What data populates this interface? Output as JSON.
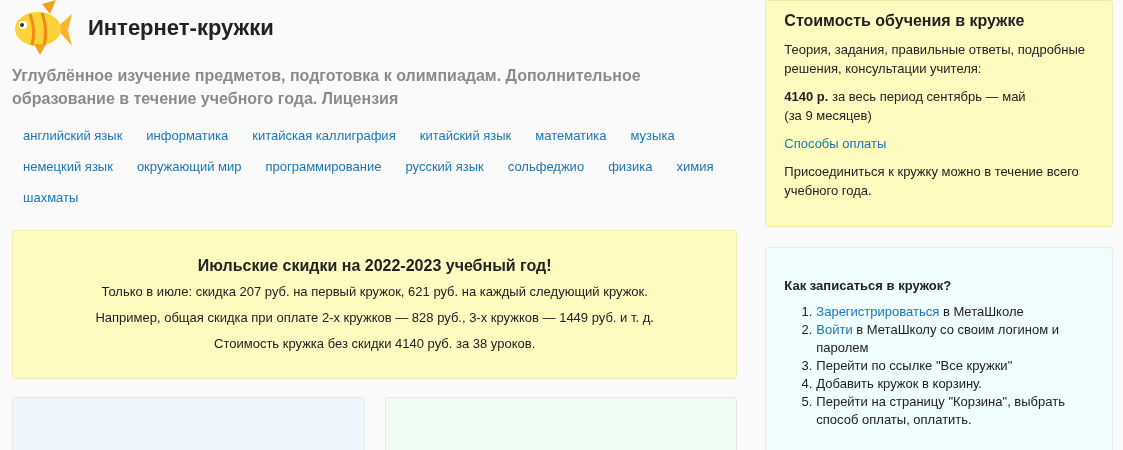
{
  "header": {
    "title": "Интернет-кружки",
    "subtitle": "Углублённое изучение предметов, подготовка к олимпиадам. Дополнительное образование в течение учебного года. Лицензия"
  },
  "subjects": [
    "английский язык",
    "информатика",
    "китайская каллиграфия",
    "китайский язык",
    "математика",
    "музыка",
    "немецкий язык",
    "окружающий мир",
    "программирование",
    "русский язык",
    "сольфеджио",
    "физика",
    "химия",
    "шахматы"
  ],
  "promo": {
    "title": "Июльские скидки на 2022-2023 учебный год!",
    "lines": [
      "Только в июле: скидка 207 руб. на первый кружок, 621 руб. на каждый следующий кружок.",
      "Например, общая скидка при оплате 2-х кружков — 828 руб., 3-х кружков — 1449 руб. и т. д.",
      "Стоимость кружка без скидки 4140 руб. за 38 уроков."
    ]
  },
  "price_card": {
    "title": "Стоимость обучения в кружке",
    "intro": "Теория, задания, правильные ответы, подробные решения, консультации учителя:",
    "price_lines": [
      "**4140 р.** за весь период сентябрь — май",
      "(за 9 месяцев)"
    ],
    "payment_link": "Способы оплаты",
    "note": "Присоединиться к кружку можно в течение всего учебного года."
  },
  "signup_card": {
    "title": "Как записаться в кружок?",
    "steps": [
      {
        "number": "1.",
        "link": "Зарегистрироваться",
        "text": " в МетаШколе"
      },
      {
        "number": "2.",
        "link": "Войти",
        "text": " в МетаШколу со своим логином и паролем"
      },
      {
        "number": "3.",
        "text": "Перейти по ссылке \"Все кружки\""
      },
      {
        "number": "4.",
        "text": "Добавить кружок в корзину."
      },
      {
        "number": "5.",
        "text": "Перейти на страницу \"Корзина\", выбрать способ оплаты, оплатить."
      }
    ]
  },
  "bottom_cards": [
    {
      "color": "#eef5fd"
    },
    {
      "color": "#effcf2"
    }
  ]
}
